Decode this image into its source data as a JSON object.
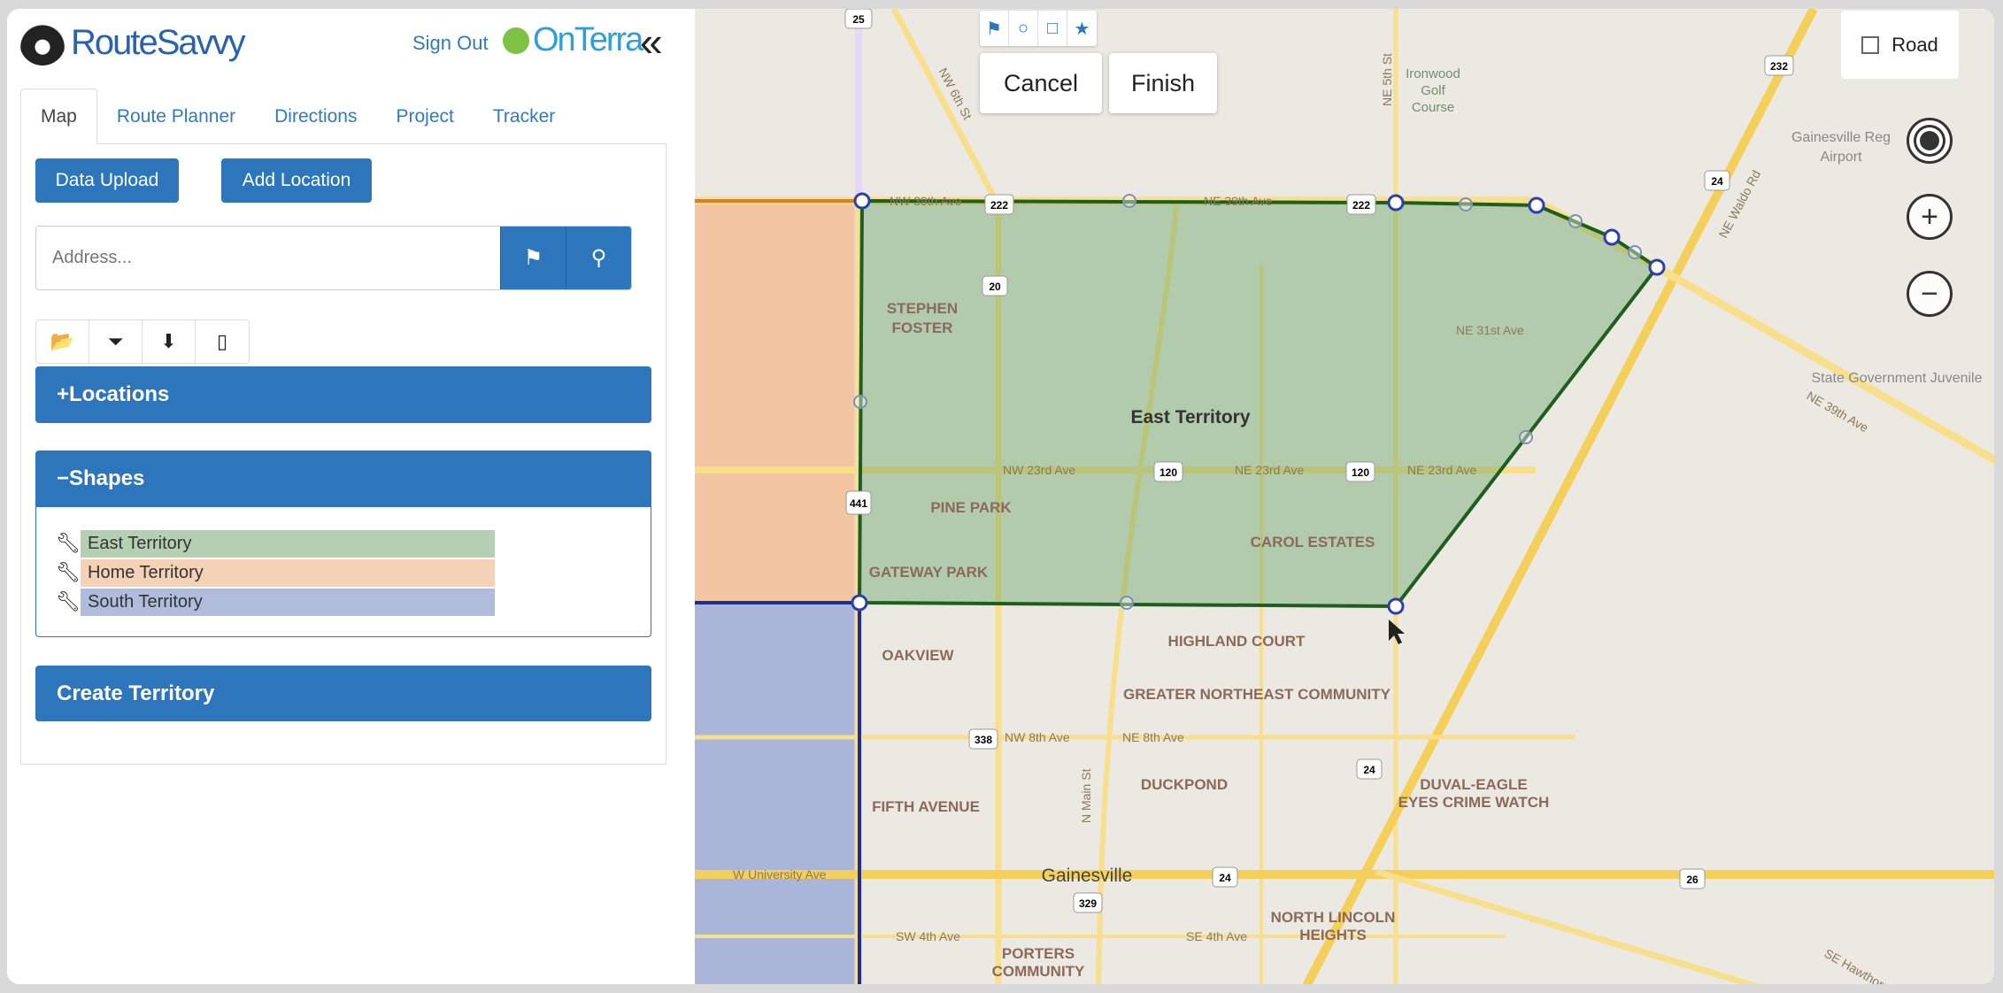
{
  "header": {
    "brand": "RouteSavvy",
    "sign_out": "Sign Out",
    "partner": "OnTerra",
    "collapse_icon": "double-chevron-left"
  },
  "tabs": [
    {
      "label": "Map",
      "active": true
    },
    {
      "label": "Route Planner"
    },
    {
      "label": "Directions"
    },
    {
      "label": "Project"
    },
    {
      "label": "Tracker"
    }
  ],
  "actions": {
    "data_upload": "Data Upload",
    "add_location": "Add Location"
  },
  "address": {
    "placeholder": "Address...",
    "value": ""
  },
  "panels": {
    "locations": "Locations",
    "locations_sign": "+",
    "shapes": "Shapes",
    "shapes_sign": "−"
  },
  "shapes": [
    {
      "name": "East Territory",
      "color": "#b5cfb3"
    },
    {
      "name": "Home Territory",
      "color": "#f3d2b7"
    },
    {
      "name": "South Territory",
      "color": "#b0bcdb"
    }
  ],
  "create_territory": "Create Territory",
  "map": {
    "cancel": "Cancel",
    "finish": "Finish",
    "map_type": "Road",
    "territory_colors": {
      "east": "#5f9e5c",
      "home": "#f0b88d",
      "south": "#8b9fd2",
      "edge": "#1e5e1e"
    },
    "areas": [
      "East Territory",
      "STEPHEN",
      "FOSTER",
      "PINE PARK",
      "GATEWAY PARK",
      "CAROL ESTATES",
      "HIGHLAND COURT",
      "OAKVIEW",
      "GREATER NORTHEAST COMMUNITY",
      "DUCKPOND",
      "FIFTH AVENUE",
      "DUVAL-EAGLE",
      "EYES CRIME WATCH",
      "Gainesville",
      "NORTH LINCOLN",
      "HEIGHTS",
      "PORTERS",
      "COMMUNITY",
      "Ironwood",
      "Golf",
      "Course",
      "Gainesville Reg",
      "Airport",
      "State Government Juvenile"
    ],
    "streets": [
      "NW 39th Ave",
      "NE 39th Ave",
      "NE 31st Ave",
      "NW 23rd Ave",
      "NE 23rd Ave",
      "NE 23rd Ave",
      "NW 8th Ave",
      "NE 8th Ave",
      "W University Ave",
      "SW 4th Ave",
      "SE 4th Ave",
      "NE Waldo Rd",
      "N Main St",
      "NW 6th St",
      "NE 5th St",
      "NE 39th Ave",
      "SE Hawthorne"
    ],
    "shields": [
      "25",
      "222",
      "222",
      "20",
      "441",
      "120",
      "120",
      "338",
      "329",
      "24",
      "24",
      "24",
      "26",
      "232"
    ]
  }
}
